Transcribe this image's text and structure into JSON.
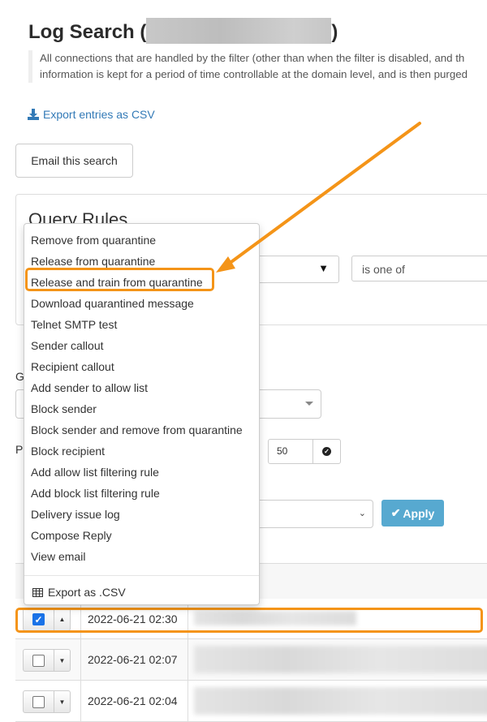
{
  "page": {
    "title_prefix": "Log Search (",
    "title_suffix": ")",
    "description_line1": "All connections that are handled by the filter (other than when the filter is disabled, and th",
    "description_line2": "information is kept for a period of time controllable at the domain level, and is then purged"
  },
  "actions": {
    "export_csv_link": "Export entries as CSV",
    "export_icon": "download-icon",
    "email_search_button": "Email this search"
  },
  "query_rules": {
    "title": "Query Rules",
    "operator_value": "is one of"
  },
  "form": {
    "group_label_partial": "G",
    "page_label_partial": "P",
    "per_page_colon": ":",
    "per_page_value": "50",
    "apply_button": "Apply"
  },
  "context_menu": {
    "items": [
      "Remove from quarantine",
      "Release from quarantine",
      "Release and train from quarantine",
      "Download quarantined message",
      "Telnet SMTP test",
      "Sender callout",
      "Recipient callout",
      "Add sender to allow list",
      "Block sender",
      "Block sender and remove from quarantine",
      "Block recipient",
      "Add allow list filtering rule",
      "Add block list filtering rule",
      "Delivery issue log",
      "Compose Reply",
      "View email"
    ],
    "highlighted_item": "Release and train from quarantine",
    "export_item": "Export as .CSV"
  },
  "table": {
    "rows": [
      {
        "date": "2022-06-21 02:30",
        "checked": true,
        "menu_open": true
      },
      {
        "date": "2022-06-21 02:07",
        "checked": false,
        "menu_open": false
      },
      {
        "date": "2022-06-21 02:04",
        "checked": false,
        "menu_open": false
      }
    ]
  },
  "annotation": {
    "color": "#f49418"
  }
}
